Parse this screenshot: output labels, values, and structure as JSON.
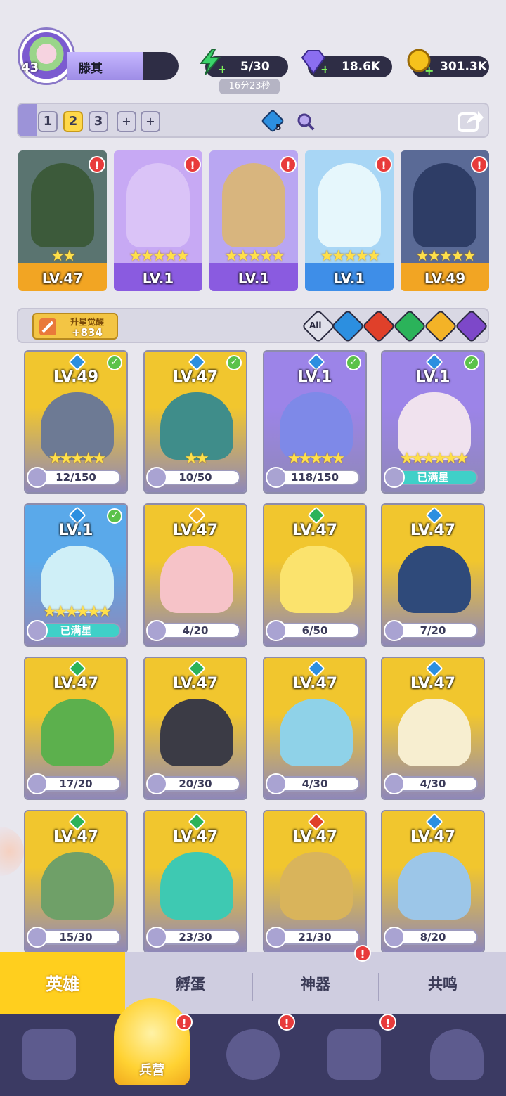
{
  "player": {
    "level": "43",
    "name": "滕其"
  },
  "resources": {
    "energy": "5/30",
    "energy_timer": "16分23秒",
    "gems": "18.6K",
    "coins": "301.3K"
  },
  "team_tabs": [
    "1",
    "2",
    "3",
    "+",
    "+"
  ],
  "team_gem_count": "5",
  "team": [
    {
      "level": "LV.47",
      "stars": "★★",
      "color": "#f2a523",
      "bg": "#3c5a3a"
    },
    {
      "level": "LV.1",
      "stars": "★★★★★",
      "color": "#8a5be0",
      "bg": "#c9a7f1"
    },
    {
      "level": "LV.1",
      "stars": "★★★★★",
      "color": "#8a5be0",
      "bg": "#d8b57e"
    },
    {
      "level": "LV.1",
      "stars": "★★★★★",
      "color": "#3e8ee8",
      "bg": "#bfe6f6"
    },
    {
      "level": "LV.49",
      "stars": "★★★★★",
      "color": "#f2a523",
      "bg": "#3c4a6e"
    }
  ],
  "star_awaken": {
    "label": "升星觉醒",
    "value": "+834"
  },
  "filters": [
    {
      "label": "All",
      "color": "#cfcfd8"
    },
    {
      "label": "",
      "color": "#2c8fe0"
    },
    {
      "label": "",
      "color": "#e0402a"
    },
    {
      "label": "",
      "color": "#2bb35a"
    },
    {
      "label": "",
      "color": "#f3b327"
    },
    {
      "label": "",
      "color": "#7d48c9"
    }
  ],
  "heroes": [
    {
      "level": "LV.49",
      "progress": "12/150",
      "stars": "★★★★★",
      "check": true,
      "bg": "#f1c62e",
      "fig": "#6d7a94",
      "gem": "#2c8fe0",
      "full": false
    },
    {
      "level": "LV.47",
      "progress": "10/50",
      "stars": "★★",
      "check": true,
      "bg": "#f1c62e",
      "fig": "#3f8d8a",
      "gem": "#2c8fe0",
      "full": false
    },
    {
      "level": "LV.1",
      "progress": "118/150",
      "stars": "★★★★★",
      "check": true,
      "bg": "#9c84e8",
      "fig": "#7e89e8",
      "gem": "#2c8fe0",
      "full": false
    },
    {
      "level": "LV.1",
      "progress": "已满星",
      "stars": "★★★★★★",
      "check": true,
      "bg": "#9c84e8",
      "fig": "#f0e2ee",
      "gem": "#2c8fe0",
      "full": true
    },
    {
      "level": "LV.1",
      "progress": "已满星",
      "stars": "★★★★★★",
      "check": true,
      "bg": "#5aa9ea",
      "fig": "#cfeff7",
      "gem": "#2c8fe0",
      "full": true
    },
    {
      "level": "LV.47",
      "progress": "4/20",
      "stars": "",
      "check": false,
      "bg": "#f1c62e",
      "fig": "#f6c3c8",
      "gem": "#f3b327",
      "full": false
    },
    {
      "level": "LV.47",
      "progress": "6/50",
      "stars": "",
      "check": false,
      "bg": "#f1c62e",
      "fig": "#fbe36d",
      "gem": "#2bb35a",
      "full": false
    },
    {
      "level": "LV.47",
      "progress": "7/20",
      "stars": "",
      "check": false,
      "bg": "#f1c62e",
      "fig": "#2f4a7a",
      "gem": "#2c8fe0",
      "full": false
    },
    {
      "level": "LV.47",
      "progress": "17/20",
      "stars": "",
      "check": false,
      "bg": "#f1c62e",
      "fig": "#5cb04d",
      "gem": "#2bb35a",
      "full": false
    },
    {
      "level": "LV.47",
      "progress": "20/30",
      "stars": "",
      "check": false,
      "bg": "#f1c62e",
      "fig": "#3b3b45",
      "gem": "#2bb35a",
      "full": false
    },
    {
      "level": "LV.47",
      "progress": "4/30",
      "stars": "",
      "check": false,
      "bg": "#f1c62e",
      "fig": "#8fd2e8",
      "gem": "#2c8fe0",
      "full": false
    },
    {
      "level": "LV.47",
      "progress": "4/30",
      "stars": "",
      "check": false,
      "bg": "#f1c62e",
      "fig": "#f7eed0",
      "gem": "#2c8fe0",
      "full": false
    },
    {
      "level": "LV.47",
      "progress": "15/30",
      "stars": "",
      "check": false,
      "bg": "#f1c62e",
      "fig": "#6fa068",
      "gem": "#2bb35a",
      "full": false
    },
    {
      "level": "LV.47",
      "progress": "23/30",
      "stars": "",
      "check": false,
      "bg": "#f1c62e",
      "fig": "#3ec9b2",
      "gem": "#2bb35a",
      "full": false
    },
    {
      "level": "LV.47",
      "progress": "21/30",
      "stars": "",
      "check": false,
      "bg": "#f1c62e",
      "fig": "#d9b45b",
      "gem": "#e0402a",
      "full": false
    },
    {
      "level": "LV.47",
      "progress": "8/20",
      "stars": "",
      "check": false,
      "bg": "#f1c62e",
      "fig": "#9cc6e8",
      "gem": "#2c8fe0",
      "full": false
    }
  ],
  "subtabs": [
    {
      "label": "英雄",
      "active": true,
      "alert": false
    },
    {
      "label": "孵蛋",
      "active": false,
      "alert": false
    },
    {
      "label": "神器",
      "active": false,
      "alert": true
    },
    {
      "label": "共鸣",
      "active": false,
      "alert": false
    }
  ],
  "bottom_nav": {
    "active_label": "兵营",
    "alert_mark": "!",
    "icons": [
      "cards-icon",
      "barracks-icon",
      "map-icon",
      "shrine-icon",
      "mushroom-icon"
    ]
  }
}
